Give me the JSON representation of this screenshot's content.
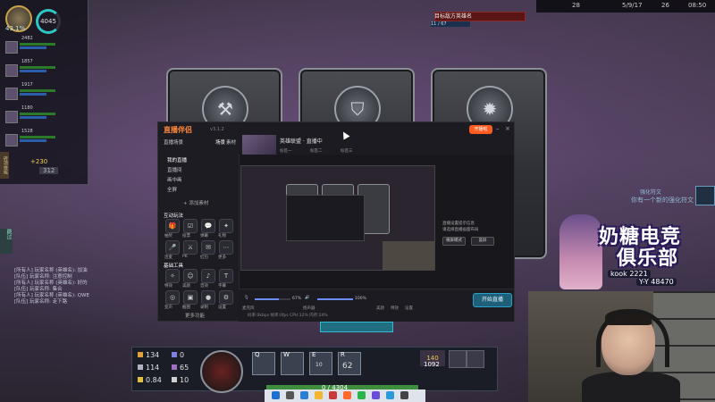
{
  "game": {
    "hud_top": {
      "level_ring_value": "4045",
      "kda": "43.1%",
      "side_gold": "+230",
      "side_timer": "312",
      "side_vertical": "砖项技能",
      "side_tab": "跳过",
      "allies": [
        {
          "num": "2482"
        },
        {
          "num": "1857"
        },
        {
          "num": "1917"
        },
        {
          "num": "1180"
        },
        {
          "num": "1528"
        }
      ]
    },
    "top_status": {
      "kills": "28",
      "score": "5/9/17",
      "cs": "26",
      "time": "08:50"
    },
    "enemy": {
      "name": "目标敌方英雄名",
      "hp": "11 / 67"
    },
    "enhance": {
      "label": "强化符文",
      "sub": "你有一个新的强化符文"
    },
    "bottom_hud": {
      "stats": [
        {
          "value": "134"
        },
        {
          "value": "114"
        },
        {
          "value": "0.84"
        },
        {
          "value": "0"
        },
        {
          "value": "65"
        },
        {
          "value": "10"
        }
      ],
      "skills": [
        {
          "key": "Q",
          "label": ""
        },
        {
          "key": "W",
          "label": ""
        },
        {
          "key": "E",
          "label": "10"
        },
        {
          "key": "R",
          "label": "62"
        }
      ],
      "gold": "140",
      "gold2": "1092",
      "hp_text": "0 / 4304"
    },
    "chat_lines": [
      "[所有人] 玩家名称 (英雄名): 加油",
      "[队伍] 玩家名称: 注意控制",
      "[所有人] 玩家名称 (英雄名): 好的",
      "[队伍] 玩家名称: 集合",
      "[所有人] 玩家名称 (英雄名): QWE",
      "[队伍] 玩家名称: 走下路"
    ]
  },
  "club": {
    "title_line1": "奶糖电竞",
    "title_line2": "俱乐部",
    "kook": "kook 2221",
    "yy": "Y-Y 48470"
  },
  "app": {
    "logo": "直播伴侣",
    "version": "v3.1.2",
    "header_title": "英雄联盟 · 直播中",
    "tags": [
      "标签一",
      "标签二",
      "标签三"
    ],
    "live_button": "开播啦",
    "side": {
      "section_label": "直播场景",
      "scene_tab1": "场景",
      "scene_tab2": "素材",
      "scene_items": [
        "我的直播",
        "直播间",
        "画中画",
        "全屏"
      ],
      "add_scene": "+ 添加素材",
      "tools_section": "互动玩法",
      "tools_row1": [
        "抽奖",
        "投票",
        "弹幕",
        "礼物"
      ],
      "tools_row2": [
        "连麦",
        "PK",
        "红包",
        "更多"
      ],
      "tools_section2": "基础工具",
      "tools_row3": [
        "特效",
        "美颜",
        "音效",
        "字幕"
      ],
      "tools_row4": [
        "变声",
        "截图",
        "录制",
        "设置"
      ],
      "more_tools": "更多功能"
    },
    "settings": {
      "line1": "直播设置提示信息",
      "line2": "请选择直播画面布局",
      "btn1": "横屏模式",
      "btn2": "竖屏"
    },
    "footer": {
      "mic_label": "麦克风",
      "mic_value": "67%",
      "speaker_label": "扬声器",
      "speaker_value": "100%",
      "icons": [
        "美颜",
        "特效",
        "设置"
      ],
      "start_live": "开始直播"
    },
    "status": "码率:0kbps  帧率:0fps  CPU:12%  内存:24%"
  }
}
